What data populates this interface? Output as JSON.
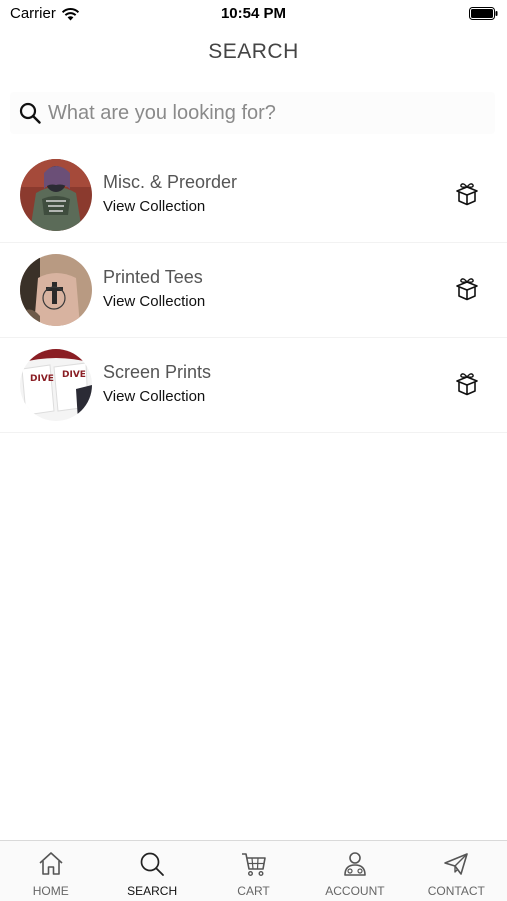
{
  "status_bar": {
    "carrier": "Carrier",
    "time": "10:54 PM"
  },
  "header": {
    "title": "SEARCH"
  },
  "search": {
    "placeholder": "What are you looking for?",
    "value": ""
  },
  "collections": [
    {
      "title": "Misc. & Preorder",
      "subtitle": "View Collection",
      "icon": "gift-box-icon"
    },
    {
      "title": "Printed Tees",
      "subtitle": "View Collection",
      "icon": "gift-box-icon"
    },
    {
      "title": "Screen Prints",
      "subtitle": "View Collection",
      "icon": "gift-box-icon"
    }
  ],
  "tab_bar": {
    "active": "search",
    "items": [
      {
        "label": "HOME",
        "icon": "home-icon"
      },
      {
        "label": "SEARCH",
        "icon": "search-icon"
      },
      {
        "label": "CART",
        "icon": "cart-icon"
      },
      {
        "label": "ACCOUNT",
        "icon": "account-icon"
      },
      {
        "label": "CONTACT",
        "icon": "send-icon"
      }
    ]
  },
  "colors": {
    "title_text": "#444444",
    "placeholder": "#8a8a8a",
    "active_tab": "#111111",
    "inactive_tab": "#666666"
  }
}
